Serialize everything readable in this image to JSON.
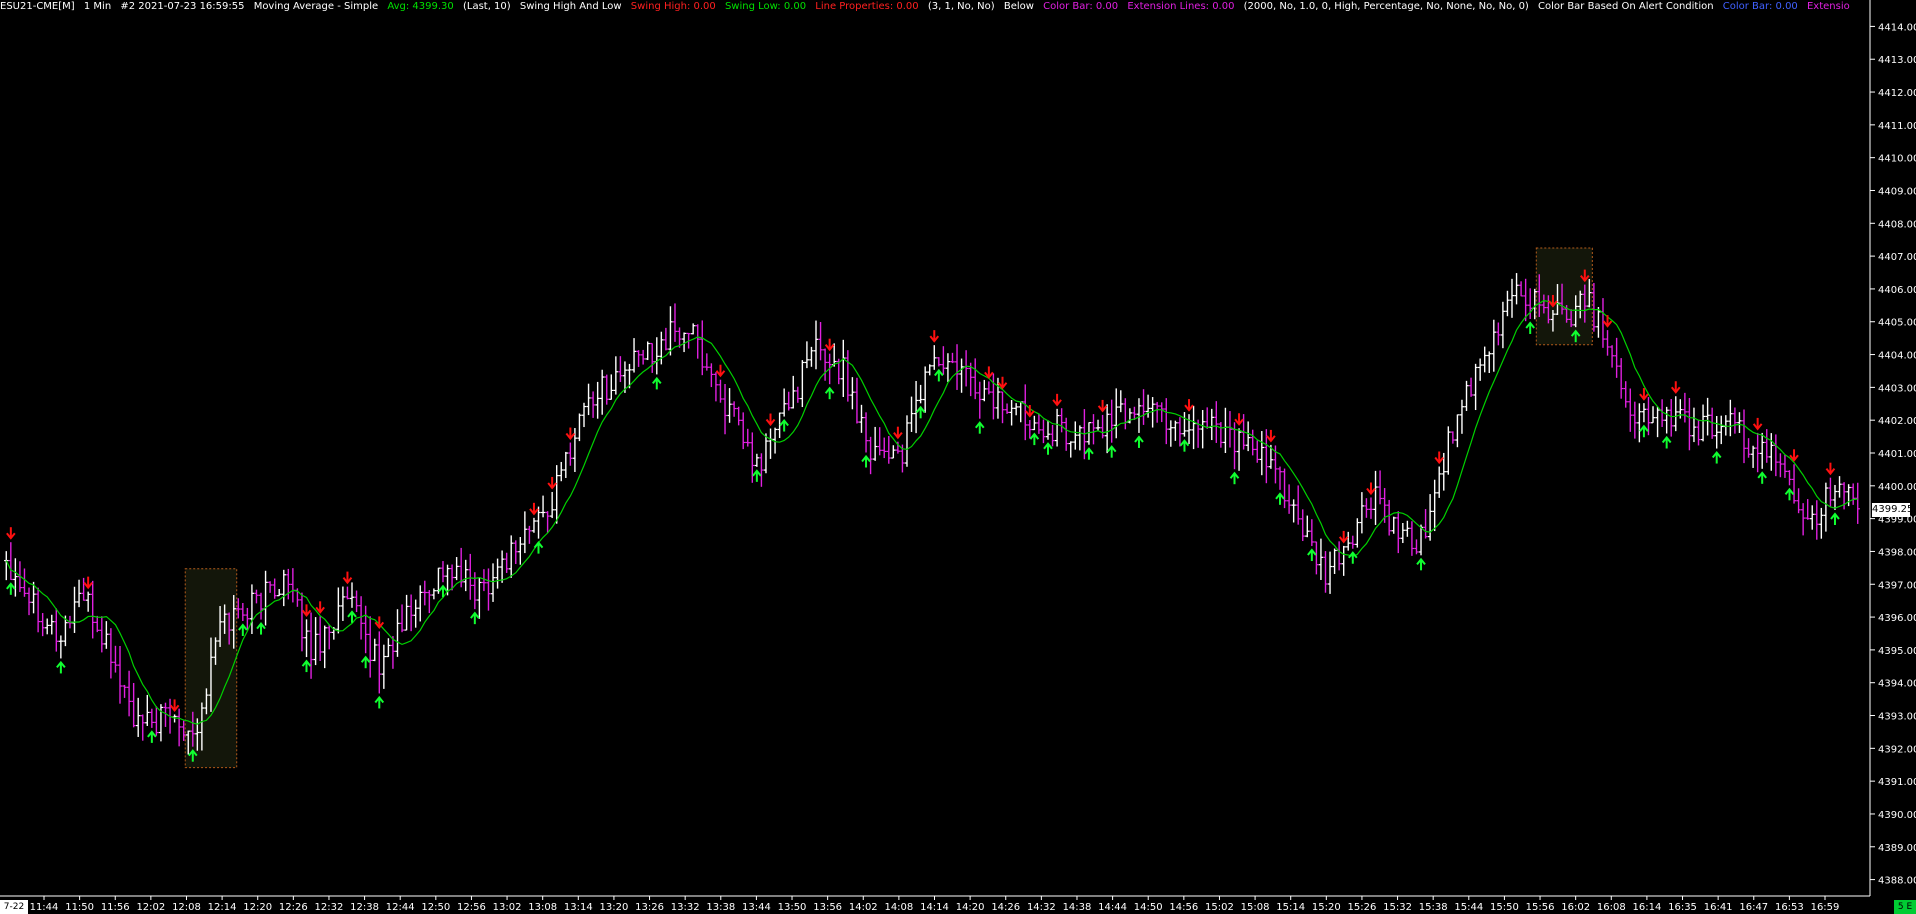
{
  "header": {
    "symbol": "ESU21-CME[M]",
    "interval": "1 Min",
    "bar_info": "#2 2021-07-23 16:59:55",
    "study_ma": "Moving Average - Simple",
    "ma_avg": "Avg: 4399.30",
    "ma_params": "(Last, 10)",
    "study_swing": "Swing High And Low",
    "swing_high": "Swing High: 0.00",
    "swing_low": "Swing Low: 0.00",
    "line_props": "Line Properties: 0.00",
    "swing_params": "(3, 1, No, No)",
    "below": "Below",
    "color_bar": "Color Bar: 0.00",
    "ext_lines": "Extension Lines: 0.00",
    "ext_params": "(2000, No, 1.0, 0, High, Percentage, No, None, No, No, 0)",
    "study_cb": "Color Bar Based On Alert Condition",
    "color_bar2": "Color Bar: 0.00",
    "extension_trunc": "Extensio"
  },
  "colors": {
    "background": "#000000",
    "bar_up": "#ffffff",
    "bar_down": "#e020e0",
    "moving_average": "#00d000",
    "swing_high_arrow": "#ff1010",
    "swing_low_arrow": "#10ff30",
    "box_border": "#b35a1a",
    "box_fill": "#13160a",
    "text": "#ffffff",
    "header_green": "#00e000",
    "header_red": "#ff2020",
    "header_magenta": "#e020e0",
    "header_blue": "#4060ff"
  },
  "last_price": "4399.25",
  "corner_label": "5 E",
  "x_start_label": "7-22",
  "chart_data": {
    "type": "bar",
    "title": "ESU21-CME[M] 1 Min",
    "ylim": [
      4387.5,
      4414.5
    ],
    "yticks": [
      "4388.00",
      "4389.00",
      "4390.00",
      "4391.00",
      "4392.00",
      "4393.00",
      "4394.00",
      "4395.00",
      "4396.00",
      "4397.00",
      "4398.00",
      "4399.00",
      "4400.00",
      "4401.00",
      "4402.00",
      "4403.00",
      "4404.00",
      "4405.00",
      "4406.00",
      "4407.00",
      "4408.00",
      "4409.00",
      "4410.00",
      "4411.00",
      "4412.00",
      "4413.00",
      "4414.00"
    ],
    "xticks": [
      "11:44",
      "11:50",
      "11:56",
      "12:02",
      "12:08",
      "12:14",
      "12:20",
      "12:26",
      "12:32",
      "12:38",
      "12:44",
      "12:50",
      "12:56",
      "13:02",
      "13:08",
      "13:14",
      "13:20",
      "13:26",
      "13:32",
      "13:38",
      "13:44",
      "13:50",
      "13:56",
      "14:02",
      "14:08",
      "14:14",
      "14:20",
      "14:26",
      "14:32",
      "14:38",
      "14:44",
      "14:50",
      "14:56",
      "15:02",
      "15:08",
      "15:14",
      "15:20",
      "15:26",
      "15:32",
      "15:38",
      "15:44",
      "15:50",
      "15:56",
      "16:02",
      "16:08",
      "16:14",
      "16:35",
      "16:41",
      "16:47",
      "16:53",
      "16:59"
    ],
    "close_anchors": [
      [
        0,
        4397.8
      ],
      [
        6,
        4396.5
      ],
      [
        12,
        4395.3
      ],
      [
        16,
        4396.8
      ],
      [
        22,
        4395.2
      ],
      [
        29,
        4392.6
      ],
      [
        36,
        4393.0
      ],
      [
        42,
        4392.6
      ],
      [
        47,
        4395.8
      ],
      [
        55,
        4396.5
      ],
      [
        61,
        4397.2
      ],
      [
        67,
        4395.0
      ],
      [
        75,
        4396.5
      ],
      [
        82,
        4394.5
      ],
      [
        88,
        4396.0
      ],
      [
        96,
        4397.5
      ],
      [
        104,
        4396.8
      ],
      [
        112,
        4398.2
      ],
      [
        120,
        4399.5
      ],
      [
        127,
        4402.5
      ],
      [
        136,
        4403.5
      ],
      [
        145,
        4404.5
      ],
      [
        150,
        4404.8
      ],
      [
        158,
        4402.5
      ],
      [
        165,
        4400.5
      ],
      [
        170,
        4402.0
      ],
      [
        178,
        4404.2
      ],
      [
        184,
        4403.5
      ],
      [
        190,
        4401.2
      ],
      [
        197,
        4401.0
      ],
      [
        203,
        4403.8
      ],
      [
        209,
        4403.5
      ],
      [
        215,
        4402.8
      ],
      [
        222,
        4402.3
      ],
      [
        230,
        4401.8
      ],
      [
        236,
        4401.5
      ],
      [
        243,
        4402.0
      ],
      [
        250,
        4402.5
      ],
      [
        258,
        4401.8
      ],
      [
        265,
        4402.0
      ],
      [
        272,
        4401.2
      ],
      [
        280,
        4400.3
      ],
      [
        286,
        4398.2
      ],
      [
        290,
        4397.2
      ],
      [
        296,
        4398.5
      ],
      [
        301,
        4399.8
      ],
      [
        306,
        4398.3
      ],
      [
        311,
        4398.3
      ],
      [
        318,
        4401.8
      ],
      [
        326,
        4404.0
      ],
      [
        331,
        4406.0
      ],
      [
        338,
        4405.5
      ],
      [
        343,
        4405.0
      ],
      [
        346,
        4406.0
      ],
      [
        352,
        4404.5
      ],
      [
        358,
        4402.0
      ],
      [
        364,
        4402.2
      ],
      [
        371,
        4401.8
      ],
      [
        379,
        4401.8
      ],
      [
        386,
        4401.0
      ],
      [
        391,
        4400.5
      ],
      [
        396,
        4399.0
      ],
      [
        402,
        4399.8
      ],
      [
        407,
        4399.3
      ]
    ],
    "swing_high_bars": [
      1,
      18,
      37,
      66,
      69,
      75,
      82,
      116,
      120,
      124,
      157,
      168,
      181,
      196,
      204,
      216,
      219,
      225,
      231,
      241,
      260,
      271,
      278,
      294,
      300,
      315,
      340,
      347,
      352,
      360,
      367,
      385,
      393,
      401,
      411
    ],
    "swing_low_bars": [
      1,
      12,
      32,
      41,
      52,
      56,
      66,
      76,
      79,
      82,
      96,
      103,
      117,
      143,
      165,
      171,
      181,
      189,
      201,
      205,
      214,
      226,
      229,
      238,
      243,
      249,
      259,
      270,
      280,
      287,
      296,
      311,
      335,
      345,
      360,
      365,
      376,
      386,
      392,
      402
    ]
  }
}
